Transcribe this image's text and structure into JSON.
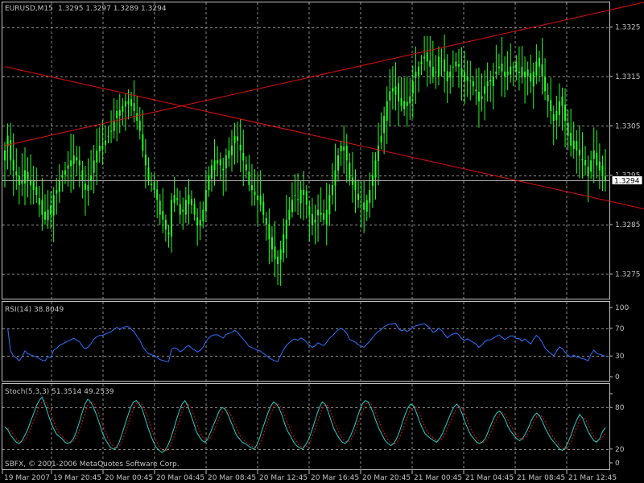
{
  "colors": {
    "background": "#000000",
    "grid": "#8a8a8a",
    "frame": "#c0c0c0",
    "text": "#c0c0c0",
    "candle": "#22ff22",
    "trendline": "#e01010",
    "rsi": "#2f6fff",
    "stoch_main": "#1fd1c8",
    "stoch_signal": "#e01010",
    "current_price_line": "#b0b0b0"
  },
  "header": {
    "symbol": "EURUSD,M15",
    "ohlc": "1.3295 1.3297 1.3289 1.3294"
  },
  "copyright": "SBFX, © 2001-2006 MetaQuotes Software Corp.",
  "chart_data": [
    {
      "type": "candlestick",
      "title": "EURUSD,M15",
      "ylim": [
        1.327,
        1.333
      ],
      "y_ticks": [
        "1.3325",
        "1.3315",
        "1.3305",
        "1.3295",
        "1.3285",
        "1.3275"
      ],
      "current_price": "1.3294",
      "x_ticks": [
        "19 Mar 2007",
        "19 Mar 20:45",
        "20 Mar 00:45",
        "20 Mar 04:45",
        "20 Mar 08:45",
        "20 Mar 12:45",
        "20 Mar 16:45",
        "20 Mar 20:45",
        "21 Mar 00:45",
        "21 Mar 04:45",
        "21 Mar 08:45",
        "21 Mar 12:45"
      ],
      "closes": [
        1.33,
        1.3303,
        1.3298,
        1.3296,
        1.3295,
        1.3293,
        1.3294,
        1.3296,
        1.3294,
        1.3293,
        1.3292,
        1.3291,
        1.3289,
        1.3287,
        1.3286,
        1.3288,
        1.3287,
        1.3291,
        1.3292,
        1.3294,
        1.3295,
        1.3296,
        1.3297,
        1.3298,
        1.3299,
        1.3298,
        1.3297,
        1.3294,
        1.3292,
        1.3293,
        1.3295,
        1.3298,
        1.33,
        1.3301,
        1.3301,
        1.3302,
        1.3303,
        1.3304,
        1.3306,
        1.3308,
        1.3307,
        1.3309,
        1.331,
        1.331,
        1.3309,
        1.3308,
        1.3306,
        1.3304,
        1.33,
        1.3297,
        1.3294,
        1.3293,
        1.3292,
        1.329,
        1.3287,
        1.3286,
        1.3284,
        1.3283,
        1.329,
        1.3291,
        1.329,
        1.3287,
        1.3288,
        1.329,
        1.3291,
        1.3289,
        1.3287,
        1.3285,
        1.3286,
        1.3288,
        1.3292,
        1.3295,
        1.3297,
        1.3298,
        1.3298,
        1.3297,
        1.3296,
        1.3299,
        1.33,
        1.3301,
        1.3303,
        1.3302,
        1.33,
        1.3298,
        1.3296,
        1.3293,
        1.3292,
        1.3291,
        1.329,
        1.3289,
        1.3287,
        1.3285,
        1.3282,
        1.328,
        1.3278,
        1.3277,
        1.328,
        1.3283,
        1.3286,
        1.3288,
        1.329,
        1.3291,
        1.329,
        1.3292,
        1.3291,
        1.3289,
        1.3287,
        1.3285,
        1.3286,
        1.3288,
        1.3287,
        1.3286,
        1.3288,
        1.3291,
        1.3293,
        1.3296,
        1.3299,
        1.3301,
        1.33,
        1.3298,
        1.3294,
        1.3293,
        1.3292,
        1.329,
        1.3289,
        1.3288,
        1.329,
        1.3292,
        1.3295,
        1.3298,
        1.3301,
        1.3303,
        1.3307,
        1.331,
        1.3312,
        1.3312,
        1.3313,
        1.331,
        1.3309,
        1.331,
        1.3309,
        1.3311,
        1.3314,
        1.3316,
        1.3317,
        1.3318,
        1.3319,
        1.3318,
        1.3317,
        1.3315,
        1.3316,
        1.3319,
        1.3318,
        1.3316,
        1.3314,
        1.3316,
        1.3317,
        1.3318,
        1.3317,
        1.3315,
        1.3314,
        1.3315,
        1.3314,
        1.3313,
        1.3312,
        1.331,
        1.3311,
        1.3313,
        1.3314,
        1.3314,
        1.3315,
        1.3316,
        1.3317,
        1.3316,
        1.3315,
        1.3316,
        1.3317,
        1.3317,
        1.3316,
        1.3316,
        1.3315,
        1.3316,
        1.3315,
        1.3314,
        1.3316,
        1.3318,
        1.3317,
        1.3315,
        1.3312,
        1.331,
        1.3308,
        1.3306,
        1.3308,
        1.331,
        1.3309,
        1.3306,
        1.3303,
        1.3301,
        1.3302,
        1.33,
        1.3299,
        1.3298,
        1.3297,
        1.3295,
        1.3298,
        1.33,
        1.3297,
        1.3296,
        1.3295,
        1.3294
      ],
      "trendlines": [
        {
          "name": "",
          "from": [
            0,
            1.3301
          ],
          "to": [
            230,
            1.3331
          ]
        },
        {
          "name": "",
          "from": [
            0,
            1.3317
          ],
          "to": [
            247,
            1.3285
          ]
        }
      ]
    },
    {
      "type": "line",
      "title": "RSI(14) 38.8049",
      "label": "RSI(14)",
      "value_text": "38.8049",
      "ylim": [
        0,
        100
      ],
      "y_ticks": [
        "100",
        "70",
        "30",
        "0"
      ]
    },
    {
      "type": "line",
      "title": "Stoch(5,3,3) 51.3514 49.2539",
      "label": "Stoch(5,3,3)",
      "value_text": "51.3514 49.2539",
      "ylim": [
        0,
        100
      ],
      "y_ticks": [
        "80",
        "20",
        "0"
      ],
      "y_ticks_unlabeled": [
        100
      ],
      "main": [
        52,
        48,
        40,
        35,
        30,
        28,
        32,
        40,
        48,
        60,
        70,
        82,
        90,
        95,
        85,
        72,
        60,
        50,
        42,
        38,
        35,
        30,
        28,
        30,
        35,
        45,
        58,
        72,
        85,
        92,
        88,
        80,
        70,
        58,
        45,
        35,
        28,
        22,
        20,
        22,
        30,
        42,
        55,
        68,
        80,
        88,
        90,
        85,
        78,
        65,
        52,
        40,
        30,
        22,
        18,
        15,
        18,
        25,
        35,
        48,
        62,
        75,
        85,
        90,
        82,
        70,
        58,
        45,
        38,
        32,
        30,
        35,
        45,
        55,
        65,
        75,
        80,
        78,
        70,
        60,
        50,
        40,
        35,
        30,
        28,
        25,
        22,
        20,
        25,
        35,
        48,
        60,
        72,
        82,
        88,
        85,
        78,
        68,
        55,
        45,
        38,
        30,
        25,
        22,
        20,
        25,
        32,
        42,
        55,
        68,
        80,
        88,
        85,
        75,
        62,
        50,
        42,
        35,
        30,
        28,
        32,
        40,
        50,
        62,
        75,
        85,
        90,
        88,
        80,
        70,
        58,
        48,
        40,
        32,
        28,
        25,
        28,
        35,
        45,
        58,
        70,
        80,
        85,
        82,
        72,
        60,
        50,
        42,
        38,
        35,
        32,
        30,
        35,
        42,
        52,
        62,
        72,
        80,
        85,
        80,
        70,
        58,
        48,
        40,
        35,
        30,
        28,
        30,
        35,
        45,
        55,
        65,
        72,
        75,
        70,
        62,
        52,
        45,
        40,
        35,
        32,
        35,
        42,
        50,
        60,
        68,
        72,
        68,
        60,
        50,
        42,
        35,
        30,
        25,
        20,
        18,
        22,
        30,
        40,
        52,
        62,
        70,
        65,
        55,
        45,
        38,
        32,
        30,
        35,
        45,
        51
      ]
    }
  ]
}
